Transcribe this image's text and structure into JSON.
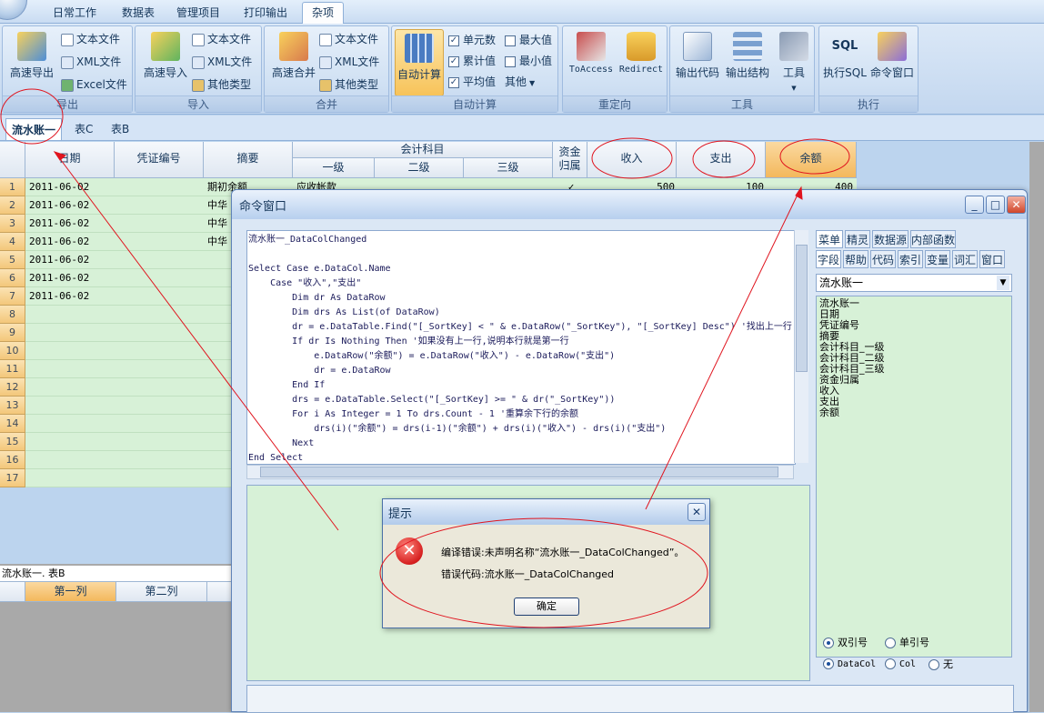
{
  "topbar": {
    "tabs": [
      "日常工作",
      "数据表",
      "管理项目",
      "打印输出",
      "杂项"
    ],
    "active_tab": "杂项"
  },
  "ribbon": {
    "groups": [
      {
        "label": "导出",
        "big": "高速导出",
        "small": [
          "文本文件",
          "XML文件",
          "Excel文件"
        ]
      },
      {
        "label": "导入",
        "big": "高速导入",
        "small": [
          "文本文件",
          "XML文件",
          "其他类型"
        ]
      },
      {
        "label": "合并",
        "big": "高速合并",
        "small": [
          "文本文件",
          "XML文件",
          "其他类型"
        ]
      },
      {
        "label": "自动计算",
        "big": "自动计算",
        "checks": [
          {
            "label": "单元数",
            "checked": true
          },
          {
            "label": "最大值",
            "checked": false
          },
          {
            "label": "累计值",
            "checked": true
          },
          {
            "label": "最小值",
            "checked": false
          },
          {
            "label": "平均值",
            "checked": true
          }
        ],
        "other": "其他"
      },
      {
        "label": "重定向",
        "buttons": [
          "ToAccess",
          "Redirect"
        ]
      },
      {
        "label": "工具",
        "buttons": [
          "输出代码",
          "输出结构",
          "工具"
        ]
      },
      {
        "label": "执行",
        "buttons": [
          "执行SQL",
          "命令窗口"
        ]
      }
    ]
  },
  "sheet_tabs": [
    "流水账一",
    "表C",
    "表B"
  ],
  "grid": {
    "columns": {
      "date": "日期",
      "voucher": "凭证编号",
      "summary": "摘要",
      "account": "会计科目",
      "level1": "一级",
      "level2": "二级",
      "level3": "三级",
      "fund_line1": "资金",
      "fund_line2": "归属",
      "income": "收入",
      "expense": "支出",
      "balance": "余额"
    },
    "row_numbers": [
      "1",
      "2",
      "3",
      "4",
      "5",
      "6",
      "7",
      "8",
      "9",
      "10",
      "11",
      "12",
      "13",
      "14",
      "15",
      "16",
      "17"
    ],
    "rows": [
      {
        "date": "2011-06-02",
        "summary": "期初余额",
        "level1": "应收帐款",
        "fund": "✓",
        "income": "500",
        "expense": "100",
        "balance": "400"
      },
      {
        "date": "2011-06-02",
        "summary": "中华"
      },
      {
        "date": "2011-06-02",
        "summary": "中华"
      },
      {
        "date": "2011-06-02",
        "summary": "中华"
      },
      {
        "date": "2011-06-02"
      },
      {
        "date": "2011-06-02"
      },
      {
        "date": "2011-06-02"
      }
    ]
  },
  "table_b": {
    "title": "流水账一. 表B",
    "columns": [
      "第一列",
      "第二列"
    ]
  },
  "cmd_window": {
    "title": "命令窗口",
    "buttons": [
      "_",
      "□",
      "✕"
    ],
    "code_lines": [
      "流水账一_DataColChanged",
      "",
      "Select Case e.DataCol.Name",
      "    Case \"收入\",\"支出\"",
      "        Dim dr As DataRow",
      "        Dim drs As List(of DataRow)",
      "        dr = e.DataTable.Find(\"[_SortKey] < \" & e.DataRow(\"_SortKey\"), \"[_SortKey] Desc\") '找出上一行",
      "        If dr Is Nothing Then '如果没有上一行,说明本行就是第一行",
      "            e.DataRow(\"余额\") = e.DataRow(\"收入\") - e.DataRow(\"支出\")",
      "            dr = e.DataRow",
      "        End If",
      "        drs = e.DataTable.Select(\"[_SortKey] >= \" & dr(\"_SortKey\"))",
      "        For i As Integer = 1 To drs.Count - 1 '重算余下行的余额",
      "            drs(i)(\"余额\") = drs(i-1)(\"余额\") + drs(i)(\"收入\") - drs(i)(\"支出\")",
      "        Next",
      "End Select"
    ],
    "right_tabs_row1": [
      "菜单",
      "精灵",
      "数据源",
      "内部函数"
    ],
    "right_tabs_row2": [
      "字段",
      "帮助",
      "代码",
      "索引",
      "变量",
      "词汇",
      "窗口"
    ],
    "combo_value": "流水账一",
    "fields": [
      "流水账一",
      "日期",
      "凭证编号",
      "摘要",
      "会计科目_一级",
      "会计科目_二级",
      "会计科目_三级",
      "资金归属",
      "收入",
      "支出",
      "余额"
    ],
    "radios": [
      {
        "label": "双引号",
        "on": true
      },
      {
        "label": "单引号",
        "on": false
      },
      {
        "label": "DataCol",
        "on": true
      },
      {
        "label": "Col",
        "on": false
      },
      {
        "label": "无",
        "on": false
      }
    ]
  },
  "dialog": {
    "title": "提示",
    "message": "编译错误:未声明名称“流水账一_DataColChanged”。",
    "code_line": "错误代码:流水账一_DataColChanged",
    "ok": "确定",
    "close": "✕"
  },
  "colors": {
    "annotation": "#e0141e",
    "grid_green": "#d7f1d7",
    "row_header_orange": "#f3c77a"
  }
}
